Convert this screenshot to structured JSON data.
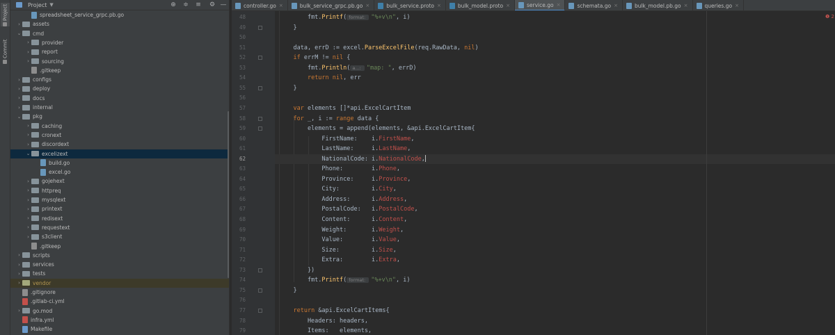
{
  "toolstrip": {
    "project_label": "Project",
    "commit_label": "Commit"
  },
  "project": {
    "title": "Project",
    "items": [
      {
        "label": "spreadsheet_service_grpc.pb.go",
        "type": "file",
        "depth": 2,
        "icon": "go-file-icon"
      },
      {
        "label": "assets",
        "type": "folder",
        "depth": 1,
        "expanded": false
      },
      {
        "label": "cmd",
        "type": "folder",
        "depth": 1,
        "expanded": true
      },
      {
        "label": "provider",
        "type": "folder",
        "depth": 2,
        "expanded": false
      },
      {
        "label": "report",
        "type": "folder",
        "depth": 2,
        "expanded": false
      },
      {
        "label": "sourcing",
        "type": "folder",
        "depth": 2,
        "expanded": false
      },
      {
        "label": ".gitkeep",
        "type": "file",
        "depth": 2,
        "icon": "git-file-icon"
      },
      {
        "label": "configs",
        "type": "folder",
        "depth": 1,
        "expanded": false
      },
      {
        "label": "deploy",
        "type": "folder",
        "depth": 1,
        "expanded": false
      },
      {
        "label": "docs",
        "type": "folder",
        "depth": 1,
        "expanded": false
      },
      {
        "label": "internal",
        "type": "folder",
        "depth": 1,
        "expanded": false
      },
      {
        "label": "pkg",
        "type": "folder",
        "depth": 1,
        "expanded": true
      },
      {
        "label": "caching",
        "type": "folder",
        "depth": 2,
        "expanded": false
      },
      {
        "label": "cronext",
        "type": "folder",
        "depth": 2,
        "expanded": false
      },
      {
        "label": "discordext",
        "type": "folder",
        "depth": 2,
        "expanded": false
      },
      {
        "label": "excelizext",
        "type": "folder",
        "depth": 2,
        "expanded": true,
        "selected": true
      },
      {
        "label": "build.go",
        "type": "file",
        "depth": 3,
        "icon": "go-file-icon"
      },
      {
        "label": "excel.go",
        "type": "file",
        "depth": 3,
        "icon": "go-file-icon"
      },
      {
        "label": "gojehext",
        "type": "folder",
        "depth": 2,
        "expanded": false
      },
      {
        "label": "httpreq",
        "type": "folder",
        "depth": 2,
        "expanded": false
      },
      {
        "label": "mysqlext",
        "type": "folder",
        "depth": 2,
        "expanded": false
      },
      {
        "label": "printext",
        "type": "folder",
        "depth": 2,
        "expanded": false
      },
      {
        "label": "redisext",
        "type": "folder",
        "depth": 2,
        "expanded": false
      },
      {
        "label": "requestext",
        "type": "folder",
        "depth": 2,
        "expanded": false
      },
      {
        "label": "s3client",
        "type": "folder",
        "depth": 2,
        "expanded": false
      },
      {
        "label": ".gitkeep",
        "type": "file",
        "depth": 2,
        "icon": "git-file-icon"
      },
      {
        "label": "scripts",
        "type": "folder",
        "depth": 1,
        "expanded": false
      },
      {
        "label": "services",
        "type": "folder",
        "depth": 1,
        "expanded": false
      },
      {
        "label": "tests",
        "type": "folder",
        "depth": 1,
        "expanded": false
      },
      {
        "label": "vendor",
        "type": "folder",
        "depth": 1,
        "expanded": false,
        "ignored": true
      },
      {
        "label": ".gitignore",
        "type": "file",
        "depth": 1,
        "icon": "git-file-icon"
      },
      {
        "label": ".gitlab-ci.yml",
        "type": "file",
        "depth": 1,
        "icon": "yml-file-icon"
      },
      {
        "label": "go.mod",
        "type": "folder",
        "depth": 1,
        "expanded": false
      },
      {
        "label": "infra.yml",
        "type": "file",
        "depth": 1,
        "icon": "yml-file-icon"
      },
      {
        "label": "Makefile",
        "type": "file",
        "depth": 1,
        "icon": "makefile-icon"
      }
    ]
  },
  "tabs": [
    {
      "label": "controller.go",
      "icon": "go-file-icon",
      "active": false
    },
    {
      "label": "bulk_service_grpc.pb.go",
      "icon": "go-file-icon",
      "active": false
    },
    {
      "label": "bulk_service.proto",
      "icon": "proto-file-icon",
      "active": false
    },
    {
      "label": "bulk_model.proto",
      "icon": "proto-file-icon",
      "active": false
    },
    {
      "label": "service.go",
      "icon": "go-file-icon",
      "active": true
    },
    {
      "label": "schemata.go",
      "icon": "go-file-icon",
      "active": false
    },
    {
      "label": "bulk_model.pb.go",
      "icon": "go-file-icon",
      "active": false
    },
    {
      "label": "queries.go",
      "icon": "go-file-icon",
      "active": false
    }
  ],
  "editor": {
    "error_badge": "❶ 2",
    "current_line": 62,
    "lines": [
      {
        "n": 48,
        "code": "        fmt.Printf(«format: »\"%+v\\n\", i)"
      },
      {
        "n": 49,
        "code": "    }"
      },
      {
        "n": 50,
        "code": ""
      },
      {
        "n": 51,
        "code": "    data, errD := excel.ParseExcelFile(req.RawData, nil)"
      },
      {
        "n": 52,
        "code": "    if errM != nil {"
      },
      {
        "n": 53,
        "code": "        fmt.Println(«a...: »\"map: \", errD)"
      },
      {
        "n": 54,
        "code": "        return nil, err"
      },
      {
        "n": 55,
        "code": "    }"
      },
      {
        "n": 56,
        "code": ""
      },
      {
        "n": 57,
        "code": "    var elements []*api.ExcelCartItem"
      },
      {
        "n": 58,
        "code": "    for _, i := range data {"
      },
      {
        "n": 59,
        "code": "        elements = append(elements, &api.ExcelCartItem{"
      },
      {
        "n": 60,
        "code": "            FirstName:    i.FirstName,"
      },
      {
        "n": 61,
        "code": "            LastName:     i.LastName,"
      },
      {
        "n": 62,
        "code": "            NationalCode: i.NationalCode,"
      },
      {
        "n": 63,
        "code": "            Phone:        i.Phone,"
      },
      {
        "n": 64,
        "code": "            Province:     i.Province,"
      },
      {
        "n": 65,
        "code": "            City:         i.City,"
      },
      {
        "n": 66,
        "code": "            Address:      i.Address,"
      },
      {
        "n": 67,
        "code": "            PostalCode:   i.PostalCode,"
      },
      {
        "n": 68,
        "code": "            Content:      i.Content,"
      },
      {
        "n": 69,
        "code": "            Weight:       i.Weight,"
      },
      {
        "n": 70,
        "code": "            Value:        i.Value,"
      },
      {
        "n": 71,
        "code": "            Size:         i.Size,"
      },
      {
        "n": 72,
        "code": "            Extra:        i.Extra,"
      },
      {
        "n": 73,
        "code": "        })"
      },
      {
        "n": 74,
        "code": "        fmt.Printf(«format: »\"%+v\\n\", i)"
      },
      {
        "n": 75,
        "code": "    }"
      },
      {
        "n": 76,
        "code": ""
      },
      {
        "n": 77,
        "code": "    return &api.ExcelCartItems{"
      },
      {
        "n": 78,
        "code": "        Headers: headers,"
      },
      {
        "n": 79,
        "code": "        Items:   elements,"
      }
    ]
  }
}
